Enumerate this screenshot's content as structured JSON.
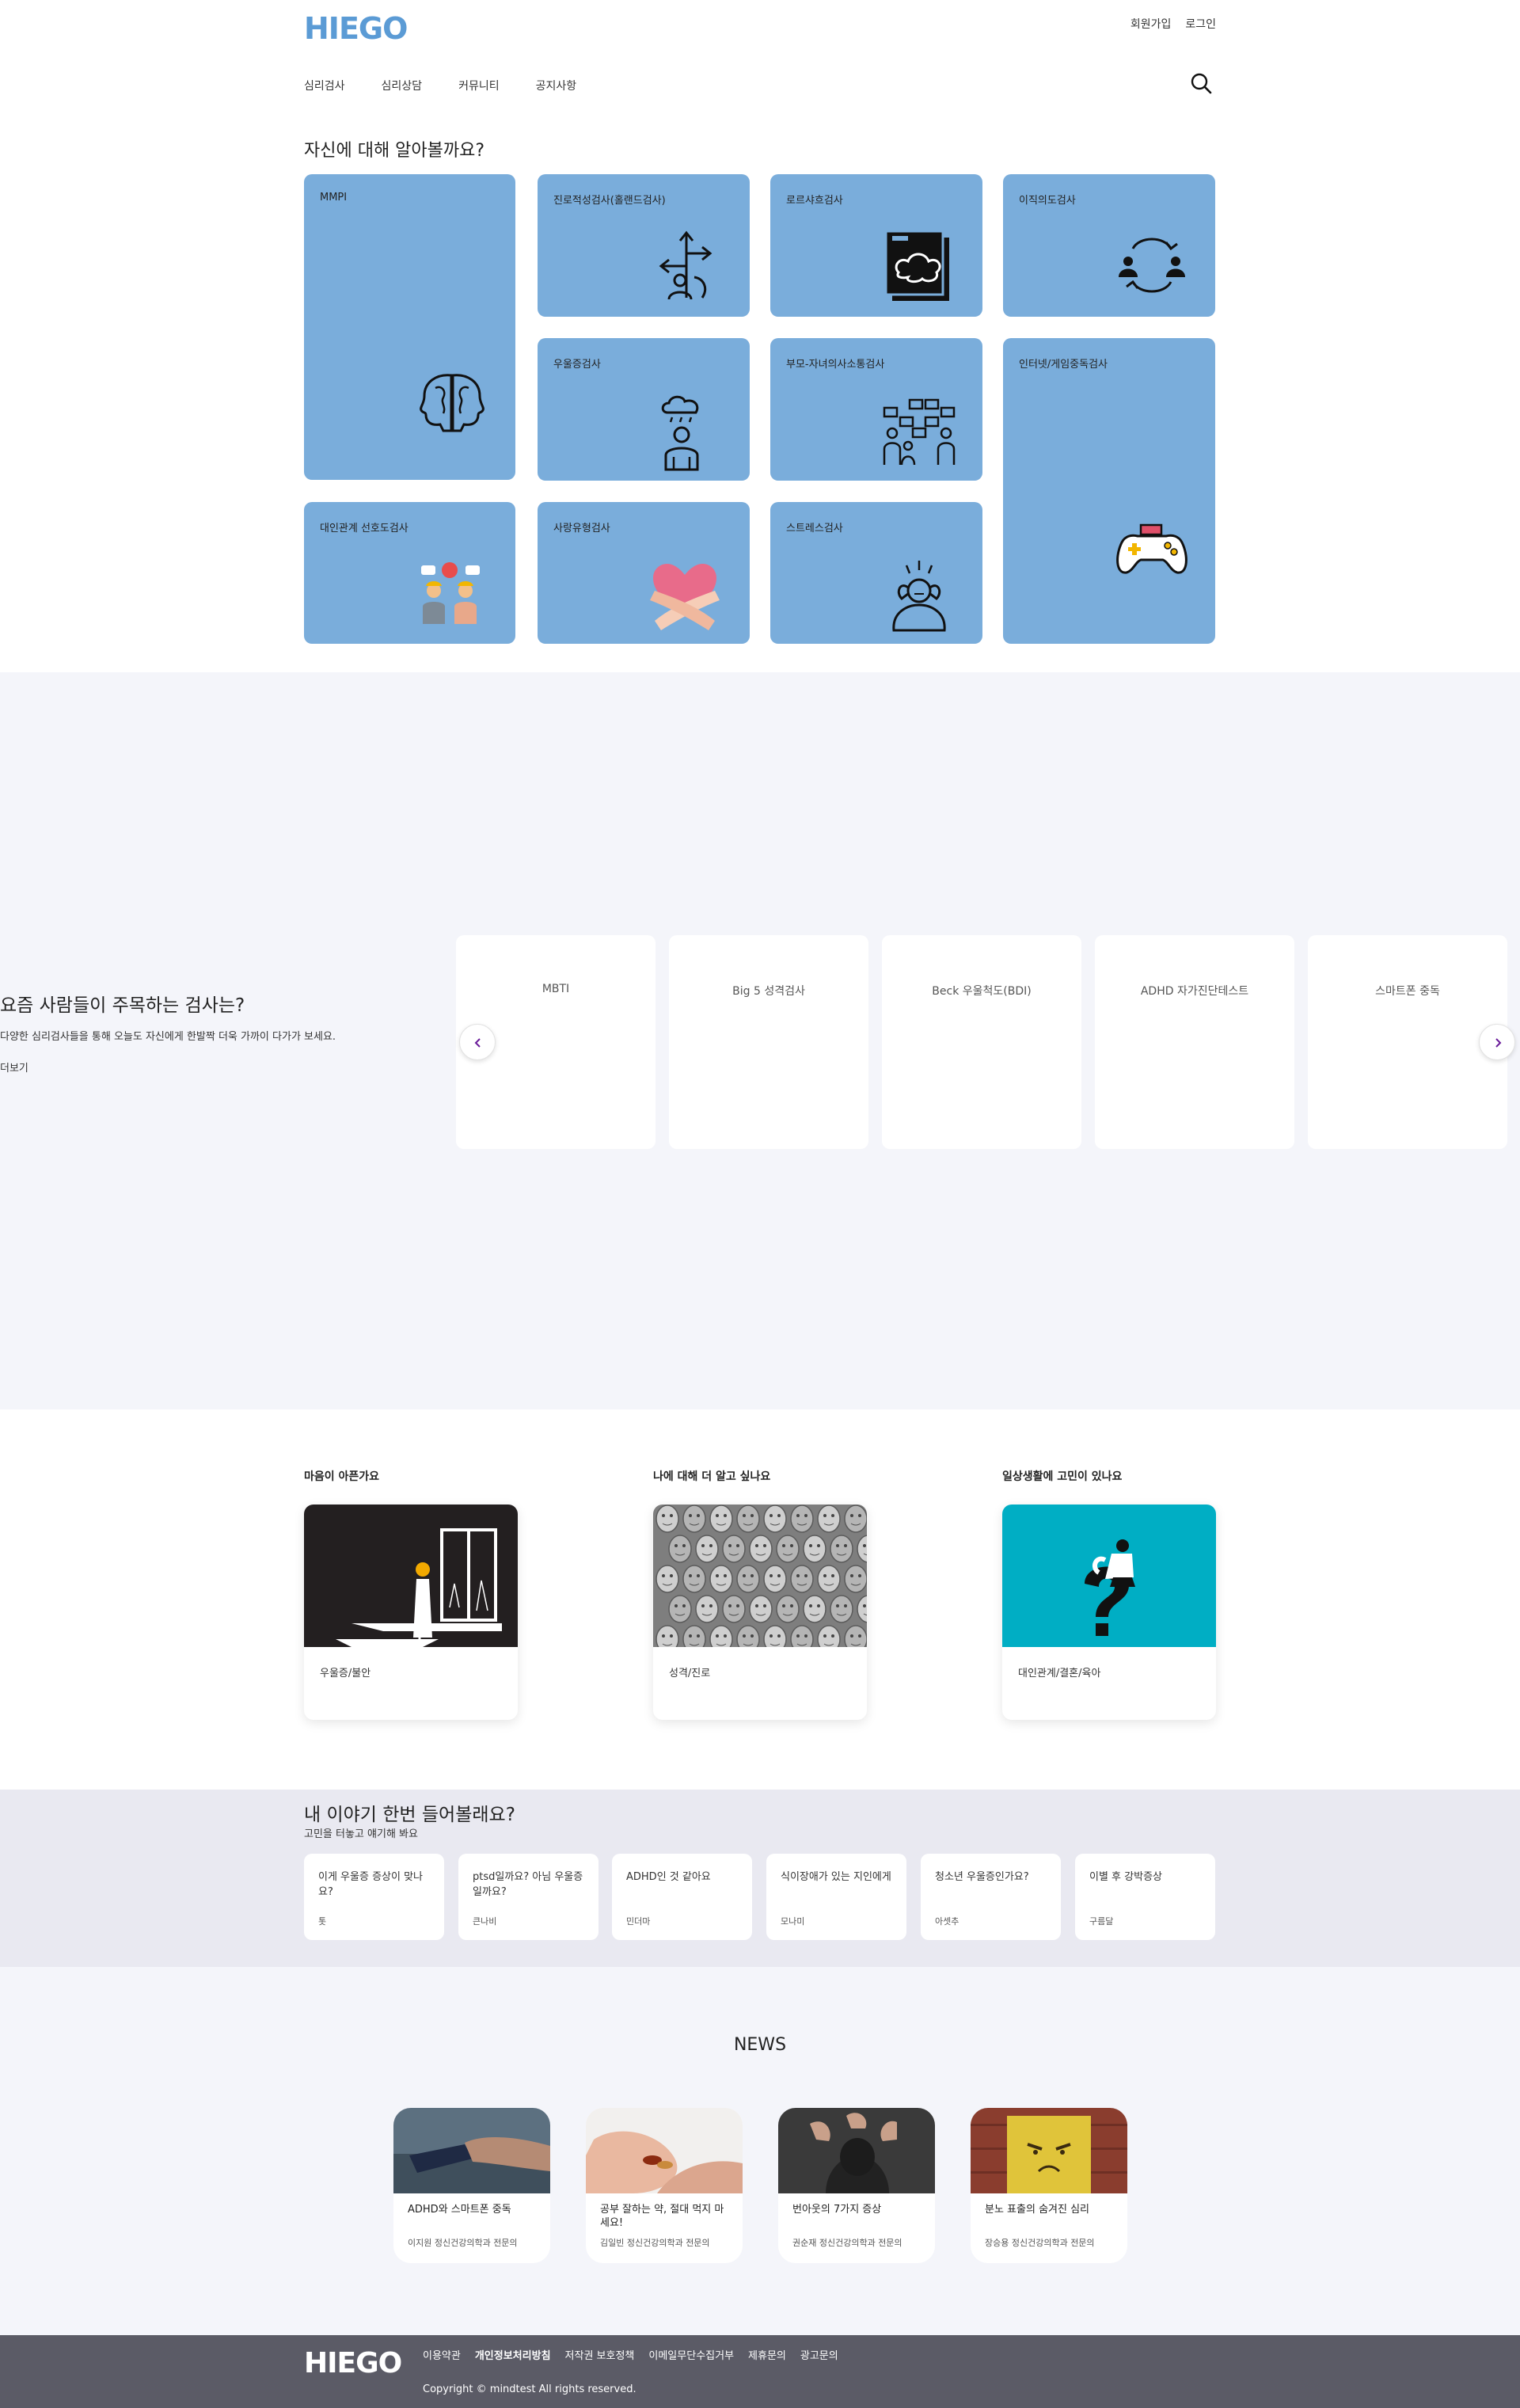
{
  "header": {
    "logo": "HIEGO",
    "top_links": [
      "회원가입",
      "로그인"
    ],
    "nav": [
      "심리검사",
      "심리상담",
      "커뮤니티",
      "공지사항"
    ]
  },
  "tests": {
    "title": "자신에 대해 알아볼까요?",
    "tiles": [
      {
        "label": "MMPI",
        "icon": "brain-heads-icon"
      },
      {
        "label": "진로적성검사(홀랜드검사)",
        "icon": "crossroad-arrows-icon"
      },
      {
        "label": "로르샤흐검사",
        "icon": "inkblot-cards-icon"
      },
      {
        "label": "이직의도검사",
        "icon": "people-exchange-icon"
      },
      {
        "label": "우울증검사",
        "icon": "rain-cloud-person-icon"
      },
      {
        "label": "부모-자녀의사소통검사",
        "icon": "family-chat-icon"
      },
      {
        "label": "인터넷/게임중독검사",
        "icon": "gamepad-icon"
      },
      {
        "label": "대인관계 선호도검사",
        "icon": "arguing-people-icon"
      },
      {
        "label": "사랑유형검사",
        "icon": "hugging-heart-icon"
      },
      {
        "label": "스트레스검사",
        "icon": "stressed-person-icon"
      }
    ]
  },
  "popular": {
    "title": "요즘 사람들이 주목하는 검사는?",
    "description": "다양한 심리검사들을 통해 오늘도 자신에게 한발짝 더욱 가까이 다가가 보세요.",
    "more": "더보기",
    "cards": [
      "MBTI",
      "Big 5 성격검사",
      "Beck 우울척도(BDI)",
      "ADHD 자가진단테스트",
      "스마트폰 중독"
    ]
  },
  "categories": [
    {
      "heading": "마음이 아픈가요",
      "caption": "우울증/불안"
    },
    {
      "heading": "나에 대해 더 알고 싶나요",
      "caption": "성격/진로"
    },
    {
      "heading": "일상생활에 고민이 있나요",
      "caption": "대인관계/결혼/육아"
    }
  ],
  "stories": {
    "title": "내 이야기 한번 들어볼래요?",
    "subtitle": "고민을 터놓고 얘기해 봐요",
    "items": [
      {
        "question": "이게 우울증 증상이 맞나요?",
        "author": "톳"
      },
      {
        "question": "ptsd일까요? 아님 우울증일까요?",
        "author": "큰나비"
      },
      {
        "question": "ADHD인 것 같아요",
        "author": "민더마"
      },
      {
        "question": "식이장애가 있는 지인에게",
        "author": "모나미"
      },
      {
        "question": "청소년 우울증인가요?",
        "author": "아셋추"
      },
      {
        "question": "이별 후 강박증상",
        "author": "구름달"
      }
    ]
  },
  "news": {
    "title": "NEWS",
    "items": [
      {
        "title": "ADHD와 스마트폰 중독",
        "doctor": "이지원 정신건강의학과 전문의"
      },
      {
        "title": "공부 잘하는 약, 절대 먹지 마세요!",
        "doctor": "김일빈 정신건강의학과 전문의"
      },
      {
        "title": "번아웃의 7가지 증상",
        "doctor": "권순재 정신건강의학과 전문의"
      },
      {
        "title": "분노 표출의 숨겨진 심리",
        "doctor": "장승용 정신건강의학과 전문의"
      }
    ]
  },
  "footer": {
    "logo": "HIEGO",
    "links": [
      "이용약관",
      "개인정보처리방침",
      "저작권 보호정책",
      "이메일무단수집거부",
      "제휴문의",
      "광고문의"
    ],
    "copyright": "Copyright © mindtest All rights reserved."
  },
  "colors": {
    "brand": "#5b9bd5",
    "tile": "#7aaddb",
    "band": "#f4f5fa",
    "story_band": "#e9e9f1",
    "footer": "#5b5b66",
    "arrow": "#6a1b9a"
  }
}
